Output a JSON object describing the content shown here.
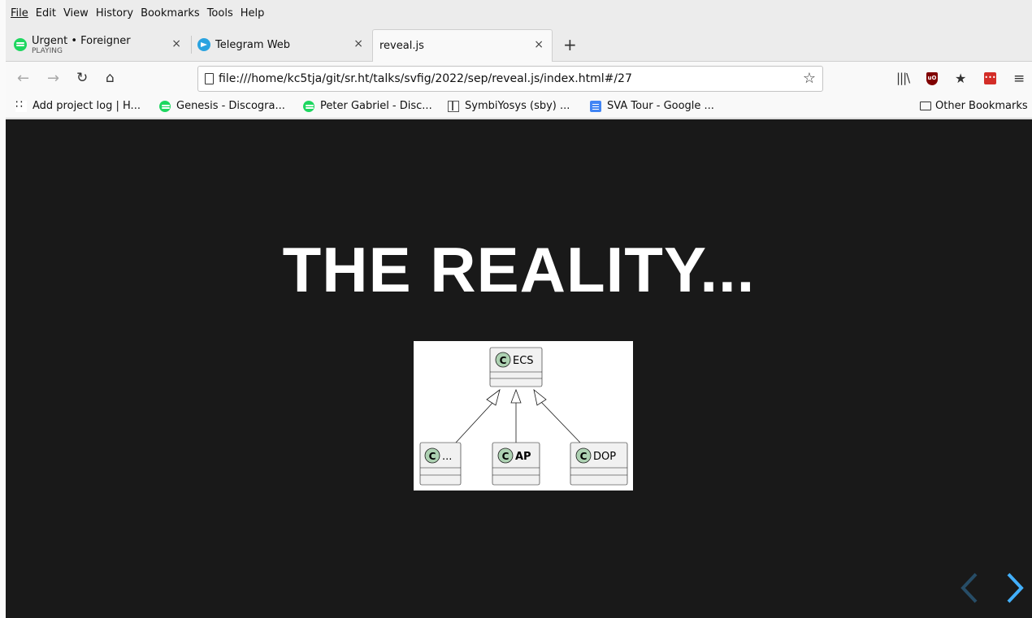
{
  "menu": {
    "file": "File",
    "edit": "Edit",
    "view": "View",
    "history": "History",
    "bookmarks": "Bookmarks",
    "tools": "Tools",
    "help": "Help"
  },
  "tabs": [
    {
      "title": "Urgent • Foreigner",
      "subtitle": "PLAYING",
      "close": "×"
    },
    {
      "title": "Telegram Web",
      "close": "×"
    },
    {
      "title": "reveal.js",
      "close": "×"
    }
  ],
  "new_tab": "+",
  "url": "file:///home/kc5tja/git/sr.ht/talks/svfig/2022/sep/reveal.js/index.html#/27",
  "bookmarks": [
    {
      "label": "Add project log | H..."
    },
    {
      "label": "Genesis - Discogra..."
    },
    {
      "label": "Peter Gabriel - Disc..."
    },
    {
      "label": "SymbiYosys (sby) ..."
    },
    {
      "label": "SVA Tour - Google ..."
    }
  ],
  "other_bookmarks": "Other Bookmarks",
  "slide": {
    "title": "THE REALITY...",
    "diagram": {
      "parent": "ECS",
      "children": [
        "...",
        "AP",
        "DOP"
      ],
      "class_marker": "C"
    }
  },
  "colors": {
    "slide_bg": "#191919",
    "slide_text": "#ffffff",
    "reveal_control": "#42affa",
    "class_circle": "#add1b2"
  }
}
